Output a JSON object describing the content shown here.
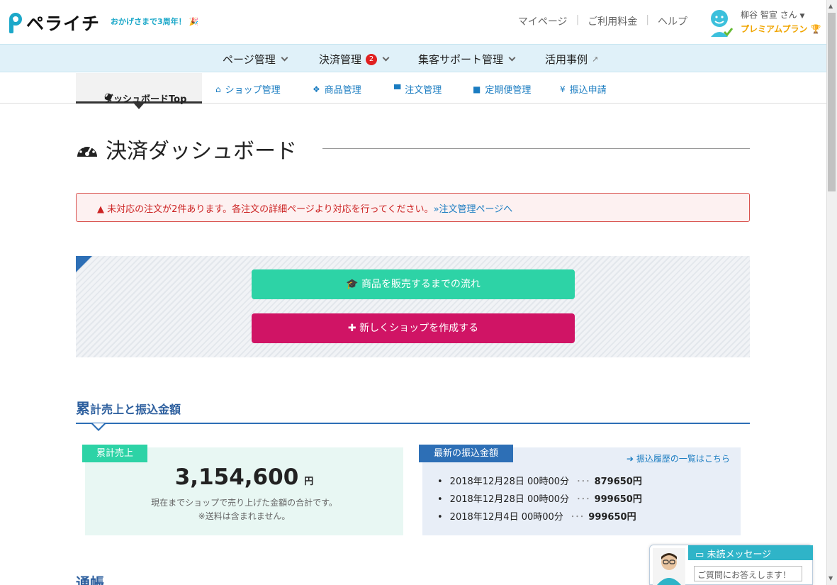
{
  "header": {
    "logo_text": "ペライチ",
    "tagline": "おかげさまで3周年！",
    "links": [
      "マイページ",
      "ご利用料金",
      "ヘルプ"
    ],
    "user_name": "柳谷 智宣 さん",
    "user_plan": "プレミアムプラン"
  },
  "main_nav": {
    "items": [
      {
        "label": "ページ管理"
      },
      {
        "label": "決済管理",
        "badge": "2"
      },
      {
        "label": "集客サポート管理"
      },
      {
        "label": "活用事例"
      }
    ]
  },
  "sub_nav": {
    "active": "ダッシュボードTop",
    "items": [
      "ショップ管理",
      "商品管理",
      "注文管理",
      "定期便管理",
      "振込申請"
    ]
  },
  "page": {
    "title": "決済ダッシュボード"
  },
  "alert": {
    "text": "未対応の注文が2件あります。各注文の詳細ページより対応を行ってください。",
    "link": "»注文管理ページへ"
  },
  "actions": {
    "flow_label": "商品を販売するまでの流れ",
    "create_label": "新しくショップを作成する"
  },
  "summary": {
    "section_first_char": "累",
    "section_rest": "計売上と振込金額",
    "total_tag": "累計売上",
    "total_value": "3,154,600",
    "total_unit": "円",
    "note_line1": "現在までショップで売り上げた金額の合計です。",
    "note_line2": "※送料は含まれません。",
    "transfer_tag": "最新の振込金額",
    "history_link": "振込履歴の一覧はこちら",
    "transfers": [
      {
        "date": "2018年12月28日 00時00分",
        "amount": "879650円"
      },
      {
        "date": "2018年12月28日 00時00分",
        "amount": "999650円"
      },
      {
        "date": "2018年12月4日 00時00分",
        "amount": "999650円"
      }
    ]
  },
  "next_section": "通帳",
  "chat": {
    "title": "未読メッセージ",
    "placeholder": "ご質問にお答えします！"
  },
  "colors": {
    "brand_teal": "#1ca8c9",
    "link_blue": "#1a7cc1",
    "accent_green": "#2dd3a6",
    "accent_magenta": "#d01465",
    "section_blue": "#2d6fb6",
    "alert_red": "#c22222"
  }
}
